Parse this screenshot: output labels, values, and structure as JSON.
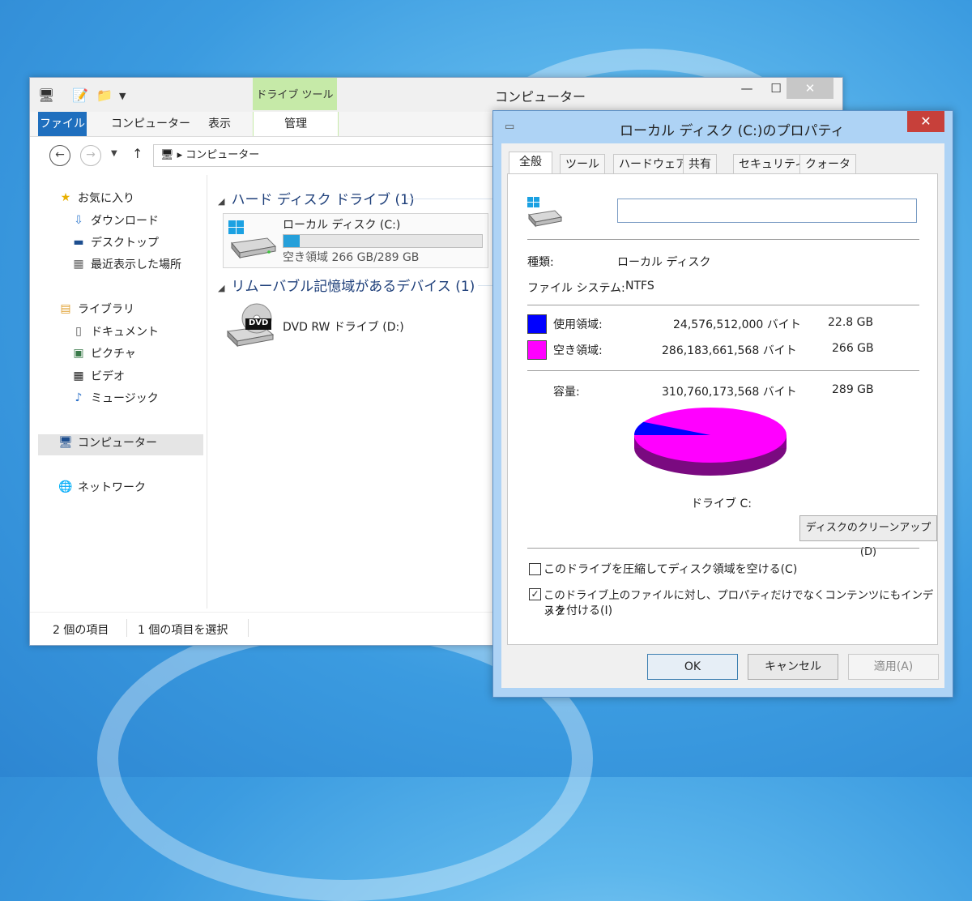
{
  "explorer": {
    "title": "コンピューター",
    "context_tab": "ドライブ ツール",
    "ribbon_tabs": [
      "ファイル",
      "コンピューター",
      "表示",
      "管理"
    ],
    "address": "コンピューター",
    "nav": {
      "favorites": "お気に入り",
      "downloads": "ダウンロード",
      "desktop": "デスクトップ",
      "recent": "最近表示した場所",
      "libraries": "ライブラリ",
      "documents": "ドキュメント",
      "pictures": "ピクチャ",
      "videos": "ビデオ",
      "music": "ミュージック",
      "computer": "コンピューター",
      "network": "ネットワーク"
    },
    "hdd_group": "ハード ディスク ドライブ (1)",
    "local_disk": {
      "name": "ローカル ディスク (C:)",
      "free_text": "空き領域 266 GB/289 GB",
      "used_fraction": 0.08
    },
    "removable_group": "リムーバブル記憶域があるデバイス (1)",
    "dvd": {
      "name": "DVD RW ドライブ (D:)",
      "badge": "DVD"
    },
    "status_items": "2 個の項目",
    "status_selected": "1 個の項目を選択"
  },
  "props": {
    "title": "ローカル ディスク (C:)のプロパティ",
    "tabs": [
      "全般",
      "ツール",
      "ハードウェア",
      "共有",
      "セキュリティ",
      "クォータ"
    ],
    "name_value": "",
    "type_label": "種類:",
    "type_value": "ローカル ディスク",
    "fs_label": "ファイル システム:",
    "fs_value": "NTFS",
    "used_label": "使用領域:",
    "used_bytes": "24,576,512,000 バイト",
    "used_gb": "22.8 GB",
    "free_label": "空き領域:",
    "free_bytes": "286,183,661,568 バイト",
    "free_gb": "266 GB",
    "cap_label": "容量:",
    "cap_bytes": "310,760,173,568 バイト",
    "cap_gb": "289 GB",
    "drive_label": "ドライブ C:",
    "cleanup_label": "ディスクのクリーンアップ(D)",
    "compress_label": "このドライブを圧縮してディスク領域を空ける(C)",
    "compress_checked": false,
    "index_label_1": "このドライブ上のファイルに対し、プロパティだけでなくコンテンツにもインデック",
    "index_label_2": "スを付ける(I)",
    "index_checked": true,
    "ok": "OK",
    "cancel": "キャンセル",
    "apply": "適用(A)",
    "used_color": "#0000ff",
    "free_color": "#ff00ff",
    "used_fraction": 0.079
  }
}
